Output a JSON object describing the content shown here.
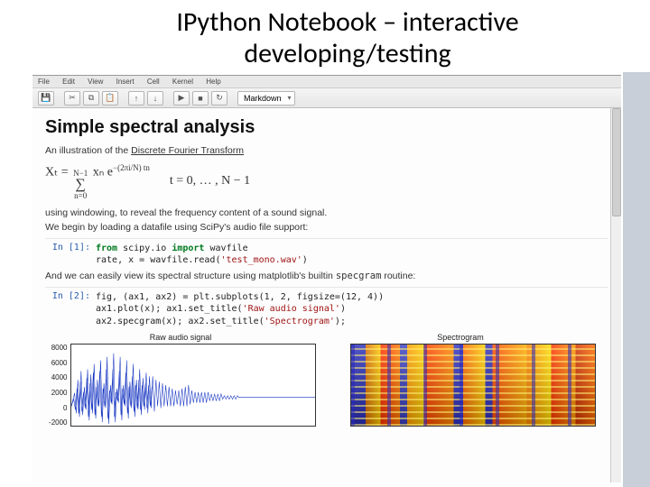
{
  "slide_title": "IPython Notebook – interactive developing/testing",
  "menubar": [
    "File",
    "Edit",
    "View",
    "Insert",
    "Cell",
    "Kernel",
    "Help"
  ],
  "toolbar": {
    "icons": [
      "save-icon",
      "cut-icon",
      "copy-icon",
      "paste-icon",
      "up-icon",
      "down-icon",
      "run-icon",
      "stop-icon",
      "restart-icon"
    ],
    "glyphs": [
      "💾",
      "✂",
      "⧉",
      "📋",
      "↑",
      "↓",
      "▶",
      "■",
      "↻"
    ],
    "celltype": "Markdown"
  },
  "nb": {
    "h1": "Simple spectral analysis",
    "intro1_a": "An illustration of the ",
    "intro1_link": "Discrete Fourier Transform",
    "eq_lhs": "Xₜ = ",
    "eq_sum_top": "N−1",
    "eq_sum_bot": "n=0",
    "eq_body": "xₙ e",
    "eq_exp": "−(2πi/N) tn",
    "eq_range": "t = 0, … , N − 1",
    "intro2": "using windowing, to reveal the frequency content of a sound signal.",
    "intro3": "We begin by loading a datafile using SciPy's audio file support:",
    "cell1": {
      "prompt": "In [1]:",
      "line1_a": "from",
      "line1_b": " scipy.io ",
      "line1_c": "import",
      "line1_d": " wavfile",
      "line2_a": "rate, x = wavfile.read(",
      "line2_str": "'test_mono.wav'",
      "line2_b": ")"
    },
    "intro4_a": "And we can easily view its spectral structure using matplotlib's builtin ",
    "intro4_b": "specgram",
    "intro4_c": " routine:",
    "cell2": {
      "prompt": "In [2]:",
      "line1": "fig, (ax1, ax2) = plt.subplots(1, 2, figsize=(12, 4))",
      "line2_a": "ax1.plot(x); ax1.set_title(",
      "line2_str": "'Raw audio signal'",
      "line2_b": ")",
      "line3_a": "ax2.specgram(x); ax2.set_title(",
      "line3_str": "'Spectrogram'",
      "line3_b": ");"
    },
    "plot1": {
      "title": "Raw audio signal",
      "yticks": [
        "8000",
        "6000",
        "4000",
        "2000",
        "0",
        "-2000"
      ]
    },
    "plot2": {
      "title": "Spectrogram"
    }
  }
}
